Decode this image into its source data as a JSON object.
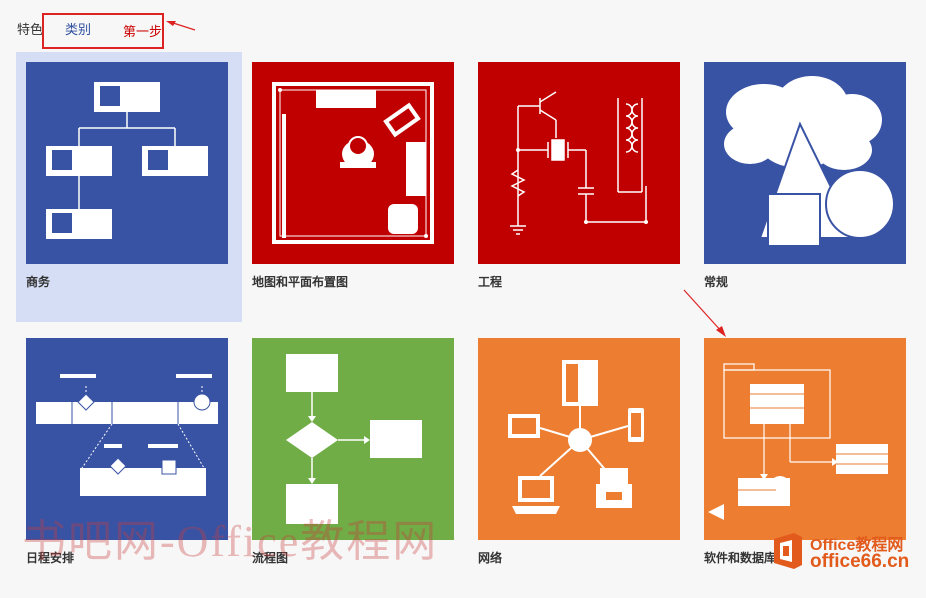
{
  "tabs": {
    "featured": "特色",
    "category": "类别"
  },
  "annotation": {
    "step_label": "第一步"
  },
  "templates": [
    {
      "label": "商务",
      "color": "#3953a4"
    },
    {
      "label": "地图和平面布置图",
      "color": "#c00000"
    },
    {
      "label": "工程",
      "color": "#c00000"
    },
    {
      "label": "常规",
      "color": "#3953a4"
    },
    {
      "label": "日程安排",
      "color": "#3953a4"
    },
    {
      "label": "流程图",
      "color": "#70ad47"
    },
    {
      "label": "网络",
      "color": "#ed7d31"
    },
    {
      "label": "软件和数据库",
      "color": "#ed7d31"
    }
  ],
  "watermark": "书吧网-Office教程网",
  "brand": {
    "top": "Office教程网",
    "bottom": "office66.cn"
  },
  "colors": {
    "accent_blue": "#3953a4",
    "red": "#c00000",
    "green": "#70ad47",
    "orange": "#ed7d31",
    "annotation_red": "#d22"
  }
}
